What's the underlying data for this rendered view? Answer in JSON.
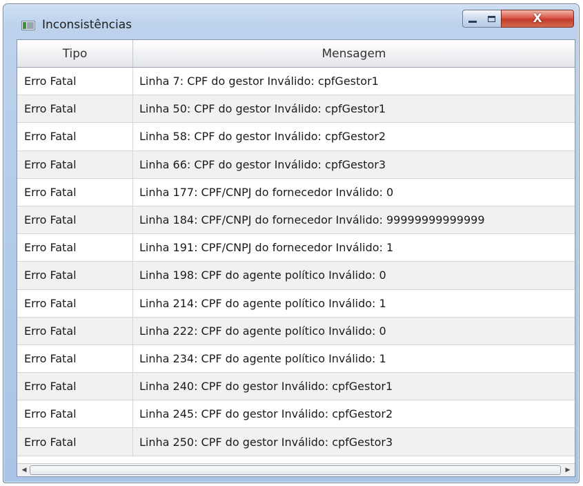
{
  "window": {
    "title": "Inconsistências",
    "minimize_icon": "minimize-icon",
    "maximize_icon": "maximize-icon",
    "close_icon": "close-icon",
    "close_glyph": "X"
  },
  "table": {
    "columns": [
      "Tipo",
      "Mensagem"
    ],
    "rows": [
      {
        "tipo": "Erro Fatal",
        "mensagem": "Linha 7: CPF do gestor Inválido: cpfGestor1"
      },
      {
        "tipo": "Erro Fatal",
        "mensagem": "Linha 50: CPF do gestor Inválido: cpfGestor1"
      },
      {
        "tipo": "Erro Fatal",
        "mensagem": "Linha 58: CPF do gestor Inválido: cpfGestor2"
      },
      {
        "tipo": "Erro Fatal",
        "mensagem": "Linha 66: CPF do gestor Inválido: cpfGestor3"
      },
      {
        "tipo": "Erro Fatal",
        "mensagem": "Linha 177: CPF/CNPJ do fornecedor Inválido: 0"
      },
      {
        "tipo": "Erro Fatal",
        "mensagem": "Linha 184: CPF/CNPJ do fornecedor Inválido: 99999999999999"
      },
      {
        "tipo": "Erro Fatal",
        "mensagem": "Linha 191: CPF/CNPJ do fornecedor Inválido: 1"
      },
      {
        "tipo": "Erro Fatal",
        "mensagem": "Linha 198: CPF do agente político Inválido: 0"
      },
      {
        "tipo": "Erro Fatal",
        "mensagem": "Linha 214: CPF do agente político Inválido: 1"
      },
      {
        "tipo": "Erro Fatal",
        "mensagem": "Linha 222: CPF do agente político Inválido: 0"
      },
      {
        "tipo": "Erro Fatal",
        "mensagem": "Linha 234: CPF do agente político Inválido: 1"
      },
      {
        "tipo": "Erro Fatal",
        "mensagem": "Linha 240: CPF do gestor Inválido: cpfGestor1"
      },
      {
        "tipo": "Erro Fatal",
        "mensagem": "Linha 245: CPF do gestor Inválido: cpfGestor2"
      },
      {
        "tipo": "Erro Fatal",
        "mensagem": "Linha 250: CPF do gestor Inválido: cpfGestor3"
      }
    ]
  },
  "scrollbar": {
    "left_icon": "scroll-left-icon",
    "right_icon": "scroll-right-icon"
  },
  "colors": {
    "titlebar": "#bcd2ec",
    "close_button": "#c23b2c",
    "row_alt": "#f1f1f1"
  }
}
